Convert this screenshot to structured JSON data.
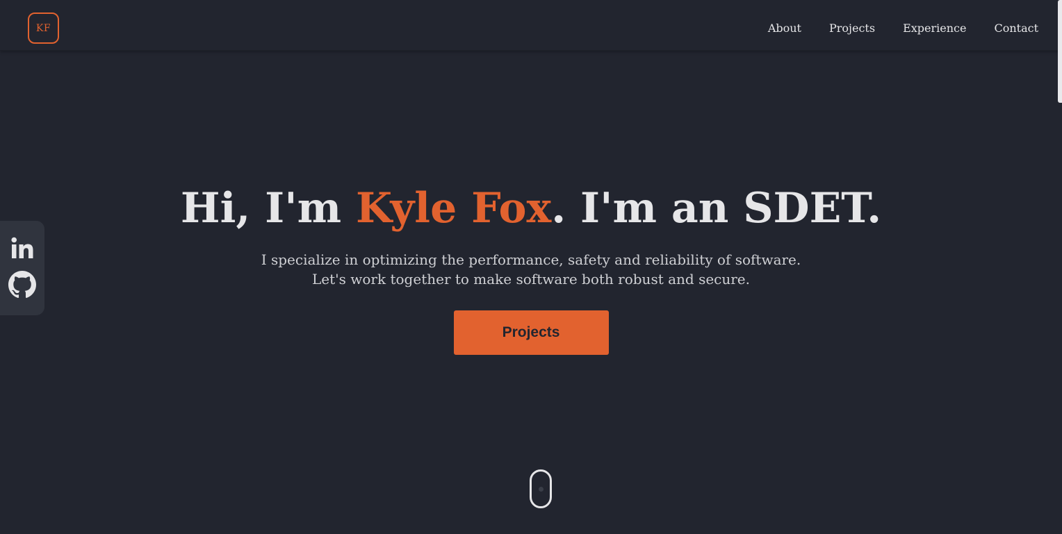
{
  "header": {
    "logo_text": "KF",
    "nav": [
      {
        "label": "About"
      },
      {
        "label": "Projects"
      },
      {
        "label": "Experience"
      },
      {
        "label": "Contact"
      }
    ]
  },
  "social": {
    "icons": [
      "linkedin-icon",
      "github-icon"
    ]
  },
  "hero": {
    "title_prefix": "Hi, I'm ",
    "title_name": "Kyle Fox",
    "title_suffix": ". I'm an SDET.",
    "subtitle_line1": "I specialize in optimizing the performance, safety and reliability of software.",
    "subtitle_line2": "Let's work together to make software both robust and secure.",
    "cta_label": "Projects"
  },
  "colors": {
    "background": "#22252f",
    "accent": "#e2622f",
    "text": "#e6e6e8",
    "social_panel": "#30343e"
  }
}
